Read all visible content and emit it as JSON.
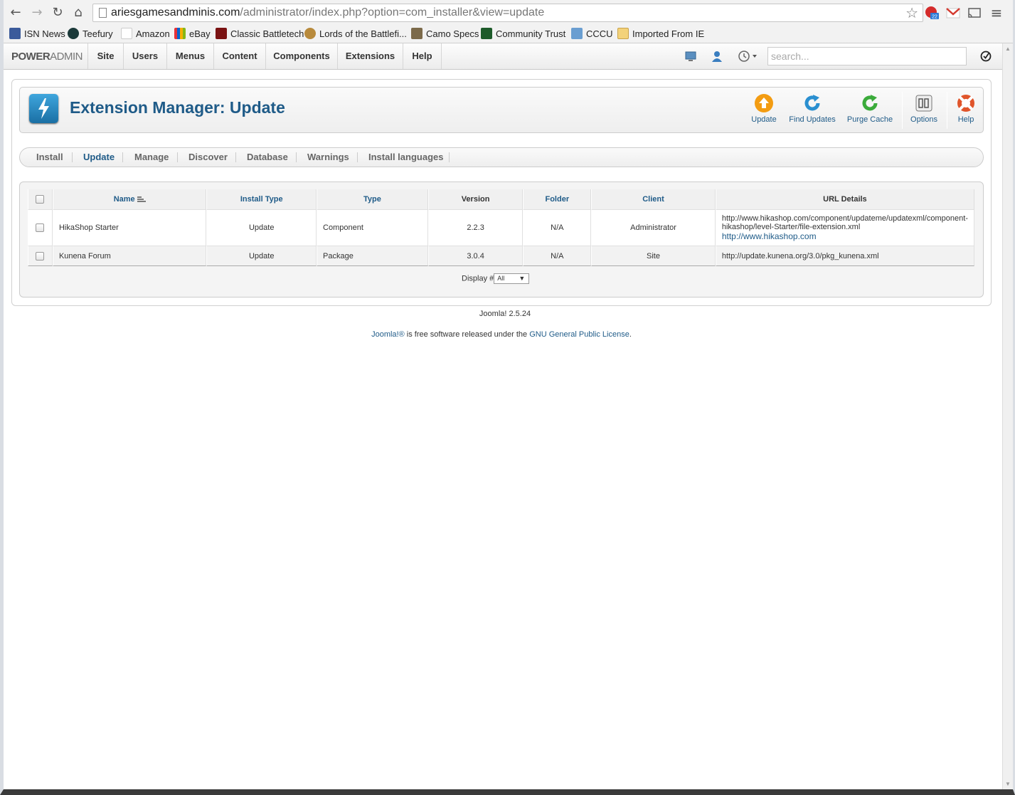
{
  "browser": {
    "url_host": "ariesgamesandminis.com",
    "url_path": "/administrator/index.php?option=com_installer&view=update",
    "ext_badge": "22",
    "bookmarks": [
      {
        "label": "ISN News",
        "icon": "isn-icon"
      },
      {
        "label": "Teefury",
        "icon": "teefury-icon"
      },
      {
        "label": "Amazon",
        "icon": "amazon-icon"
      },
      {
        "label": "eBay",
        "icon": "ebay-icon"
      },
      {
        "label": "Classic Battletech",
        "icon": "battletech-icon"
      },
      {
        "label": "Lords of the Battlefi...",
        "icon": "lords-icon"
      },
      {
        "label": "Camo Specs",
        "icon": "camo-icon"
      },
      {
        "label": "Community Trust",
        "icon": "community-trust-icon"
      },
      {
        "label": "CCCU",
        "icon": "cccu-icon"
      },
      {
        "label": "Imported From IE",
        "icon": "folder-icon"
      }
    ]
  },
  "adminbar": {
    "brand_bold": "POWER",
    "brand_light": "ADMIN",
    "menu": [
      "Site",
      "Users",
      "Menus",
      "Content",
      "Components",
      "Extensions",
      "Help"
    ],
    "search_placeholder": "search..."
  },
  "header": {
    "title": "Extension Manager: Update",
    "toolbar": [
      {
        "label": "Update",
        "icon": "update-arrow-icon"
      },
      {
        "label": "Find Updates",
        "icon": "refresh-icon"
      },
      {
        "label": "Purge Cache",
        "icon": "purge-icon"
      },
      {
        "label": "Options",
        "icon": "options-icon"
      },
      {
        "label": "Help",
        "icon": "lifebuoy-icon"
      }
    ]
  },
  "subnav": [
    "Install",
    "Update",
    "Manage",
    "Discover",
    "Database",
    "Warnings",
    "Install languages"
  ],
  "subnav_active": "Update",
  "table": {
    "columns": [
      "Name",
      "Install Type",
      "Type",
      "Version",
      "Folder",
      "Client",
      "URL Details"
    ],
    "rows": [
      {
        "name": "HikaShop Starter",
        "install_type": "Update",
        "type": "Component",
        "version": "2.2.3",
        "folder": "N/A",
        "client": "Administrator",
        "url_line1": "http://www.hikashop.com/component/updateme/updatexml/component-",
        "url_line2": "hikashop/level-Starter/file-extension.xml",
        "url_link": "http://www.hikashop.com"
      },
      {
        "name": "Kunena Forum",
        "install_type": "Update",
        "type": "Package",
        "version": "3.0.4",
        "folder": "N/A",
        "client": "Site",
        "url_line1": "http://update.kunena.org/3.0/pkg_kunena.xml"
      }
    ],
    "display_label": "Display #",
    "display_value": "All"
  },
  "footer": {
    "version": "Joomla! 2.5.24",
    "joomla_link": "Joomla!®",
    "text_middle": " is free software released under the ",
    "license_link": "GNU General Public License",
    "text_end": "."
  },
  "colors": {
    "accent": "#1f5b88",
    "update_orange": "#f39c12",
    "refresh_blue": "#2a8fd0",
    "purge_green": "#3bab3b",
    "help_red": "#e0552b"
  }
}
